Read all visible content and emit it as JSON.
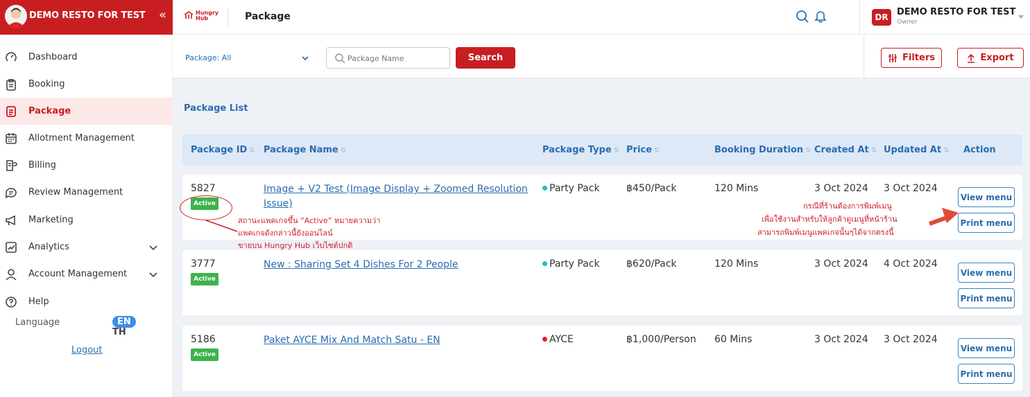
{
  "sidebar": {
    "restaurant_name": "DEMO RESTO FOR TEST",
    "items": [
      {
        "label": "Dashboard",
        "icon": "dashboard-icon"
      },
      {
        "label": "Booking",
        "icon": "clipboard-icon"
      },
      {
        "label": "Package",
        "icon": "document-icon"
      },
      {
        "label": "Allotment Management",
        "icon": "calendar-icon"
      },
      {
        "label": "Billing",
        "icon": "billing-icon"
      },
      {
        "label": "Review Management",
        "icon": "chat-icon"
      },
      {
        "label": "Marketing",
        "icon": "megaphone-icon"
      },
      {
        "label": "Analytics",
        "icon": "chart-icon"
      },
      {
        "label": "Account Management",
        "icon": "user-icon"
      },
      {
        "label": "Help",
        "icon": "help-icon"
      }
    ],
    "language_label": "Language",
    "lang_th": "TH",
    "lang_en": "EN",
    "logout": "Logout"
  },
  "topbar": {
    "logo_line1": "Hungry",
    "logo_line2": "Hub",
    "title": "Package",
    "user_initials": "DR",
    "user_name": "DEMO RESTO FOR TEST",
    "user_role": "Owner"
  },
  "filters": {
    "package_select": "Package: All",
    "search_placeholder": "Package Name",
    "search_button": "Search",
    "filters_button": "Filters",
    "export_button": "Export"
  },
  "list_title": "Package List",
  "table": {
    "headers": [
      "Package ID",
      "Package Name",
      "Package Type",
      "Price",
      "Booking Duration",
      "Created At",
      "Updated At",
      "Action"
    ],
    "rows": [
      {
        "id": "5827",
        "status": "Active",
        "name": "Image + V2 Test (Image Display + Zoomed Resolution Issue)",
        "type": "Party Pack",
        "type_color": "#1fbfb8",
        "price": "฿450/Pack",
        "duration": "120 Mins",
        "created": "3 Oct 2024",
        "updated": "3 Oct 2024"
      },
      {
        "id": "3777",
        "status": "Active",
        "name": "New : Sharing Set 4 Dishes For 2 People",
        "type": "Party Pack",
        "type_color": "#1fbfb8",
        "price": "฿620/Pack",
        "duration": "120 Mins",
        "created": "3 Oct 2024",
        "updated": "4 Oct 2024"
      },
      {
        "id": "5186",
        "status": "Active",
        "name": "Paket AYCE Mix And Match Satu - EN",
        "type": "AYCE",
        "type_color": "#e0202a",
        "price": "฿1,000/Person",
        "duration": "60 Mins",
        "created": "3 Oct 2024",
        "updated": "3 Oct 2024"
      }
    ],
    "view_menu": "View menu",
    "print_menu": "Print menu"
  },
  "annotations": {
    "left": [
      "สถานะแพคเกจขึ้น “Active” หมายความว่า",
      "แพคเกจดังกล่าวนี้ยังออนไลน์",
      "ขายบน Hungry Hub เว็บไซต์ปกติ"
    ],
    "right": [
      "กรณีที่ร้านต้องการพิมพ์เมนู",
      "เพื่อใช้งานสำหรับให้ลูกค้าดูเมนูที่หน้าร้าน",
      "สามารถพิมพ์เมนูแพคเกจนั้นๆได้จากตรงนี้"
    ]
  }
}
